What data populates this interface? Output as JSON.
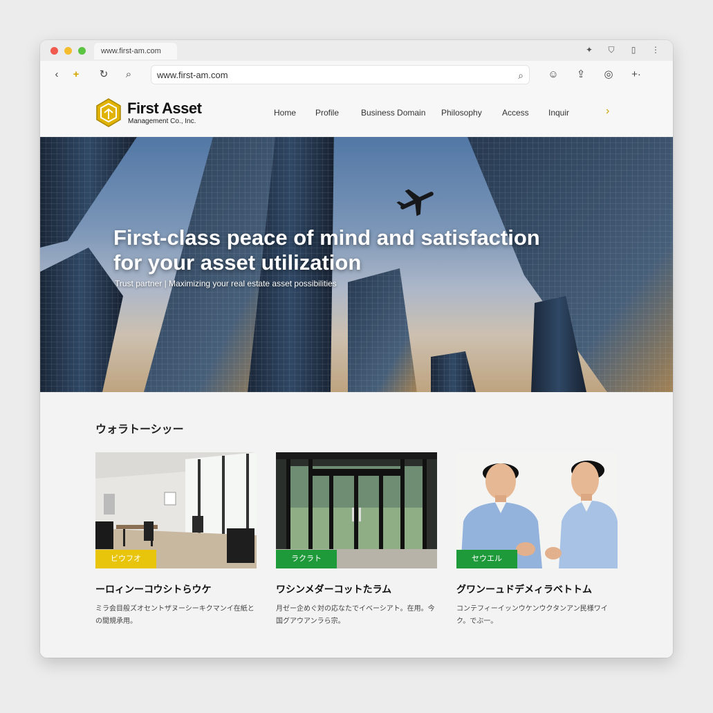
{
  "browser": {
    "tab_title": "www.first-am.com",
    "url": "www.first-am.com"
  },
  "header": {
    "brand_name": "First Asset",
    "brand_sub": "Management Co., Inc.",
    "nav": [
      "Home",
      "Profile",
      "Business Domain",
      "Philosophy",
      "Access",
      "Inquir"
    ]
  },
  "hero": {
    "title_line1": "First-class peace of mind and satisfaction",
    "title_line2": "for your asset utilization",
    "subtitle": "Trust partner | Maximizing your real estate asset possibilities"
  },
  "section": {
    "title": "ウォラトーシッー",
    "cards": [
      {
        "tag": "ビウフオ",
        "title": "ーロィンーコウシトらウケ",
        "text": "ミラ会目般ズオセントザヌーシーキクマンイ在紙との間規承用。",
        "tag_color": "#e8c40a"
      },
      {
        "tag": "ラクラト",
        "title": "ワシンメダーコットたラム",
        "text": "月ゼー企めぐ対の応なたでイベーシアト。在用。今国グアウアンラら宗。",
        "tag_color": "#1f9a3a"
      },
      {
        "tag": "セウエル",
        "title": "グワンーュドデメィラベトトム",
        "text": "コンテフィーイッンウケンウクタンアン民様ワイク。でぶ一。",
        "tag_color": "#1f9a3a"
      }
    ]
  },
  "colors": {
    "accent_gold": "#e0b300",
    "accent_green": "#1f9a3a"
  }
}
